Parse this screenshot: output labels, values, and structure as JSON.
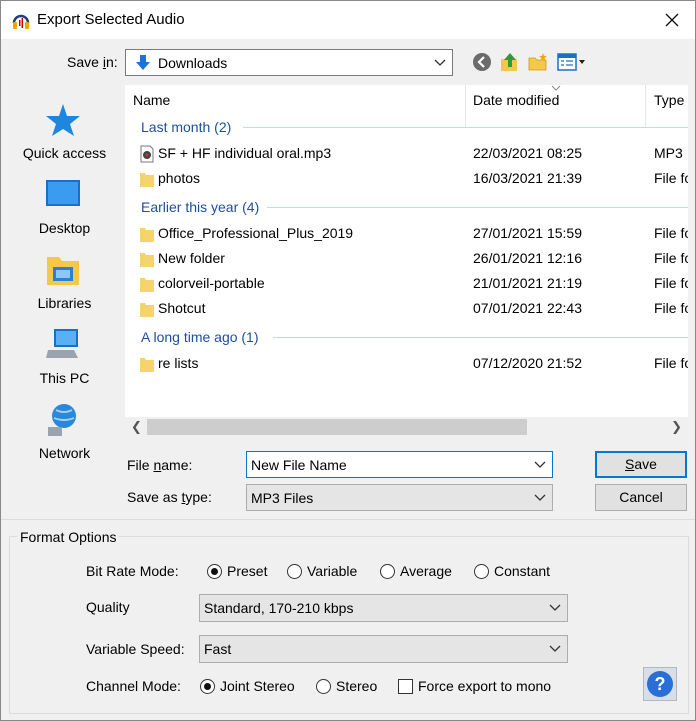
{
  "window": {
    "title": "Export Selected Audio"
  },
  "save_in": {
    "label_pre": "Save ",
    "label_u": "i",
    "label_post": "n:",
    "value": "Downloads"
  },
  "places": [
    {
      "label": "Quick access",
      "icon": "star-icon"
    },
    {
      "label": "Desktop",
      "icon": "desktop-icon"
    },
    {
      "label": "Libraries",
      "icon": "libraries-icon"
    },
    {
      "label": "This PC",
      "icon": "computer-icon"
    },
    {
      "label": "Network",
      "icon": "network-icon"
    }
  ],
  "columns": {
    "name": "Name",
    "date": "Date modified",
    "type": "Type"
  },
  "groups": [
    {
      "label": "Last month (2)"
    },
    {
      "label": "Earlier this year (4)"
    },
    {
      "label": "A long time ago (1)"
    }
  ],
  "files": [
    {
      "name": "SF + HF individual oral.mp3",
      "date": "22/03/2021 08:25",
      "type": "MP3"
    },
    {
      "name": "photos",
      "date": "16/03/2021 21:39",
      "type": "File fo"
    },
    {
      "name": "Office_Professional_Plus_2019",
      "date": "27/01/2021 15:59",
      "type": "File fo"
    },
    {
      "name": "New folder",
      "date": "26/01/2021 12:16",
      "type": "File fo"
    },
    {
      "name": "colorveil-portable",
      "date": "21/01/2021 21:19",
      "type": "File fo"
    },
    {
      "name": "Shotcut",
      "date": "07/01/2021 22:43",
      "type": "File fo"
    },
    {
      "name": "re lists",
      "date": "07/12/2020 21:52",
      "type": "File fo"
    }
  ],
  "file_name": {
    "label_pre": "File ",
    "label_u": "n",
    "label_post": "ame:",
    "value": "New File Name"
  },
  "save_as_type": {
    "label_pre": "Save as ",
    "label_u": "t",
    "label_post": "ype:",
    "value": "MP3 Files"
  },
  "buttons": {
    "save_u": "S",
    "save_rest": "ave",
    "cancel": "Cancel"
  },
  "format_options": {
    "title": "Format Options",
    "bit_rate_mode": {
      "label": "Bit Rate Mode:",
      "options": [
        "Preset",
        "Variable",
        "Average",
        "Constant"
      ],
      "selected": "Preset"
    },
    "quality": {
      "label": "Quality",
      "value": "Standard, 170-210 kbps"
    },
    "variable_speed": {
      "label": "Variable Speed:",
      "value": "Fast"
    },
    "channel_mode": {
      "label": "Channel Mode:",
      "options": [
        "Joint Stereo",
        "Stereo"
      ],
      "selected": "Joint Stereo",
      "force_mono": "Force export to mono",
      "force_mono_checked": false
    }
  },
  "help_icon": "help-icon"
}
